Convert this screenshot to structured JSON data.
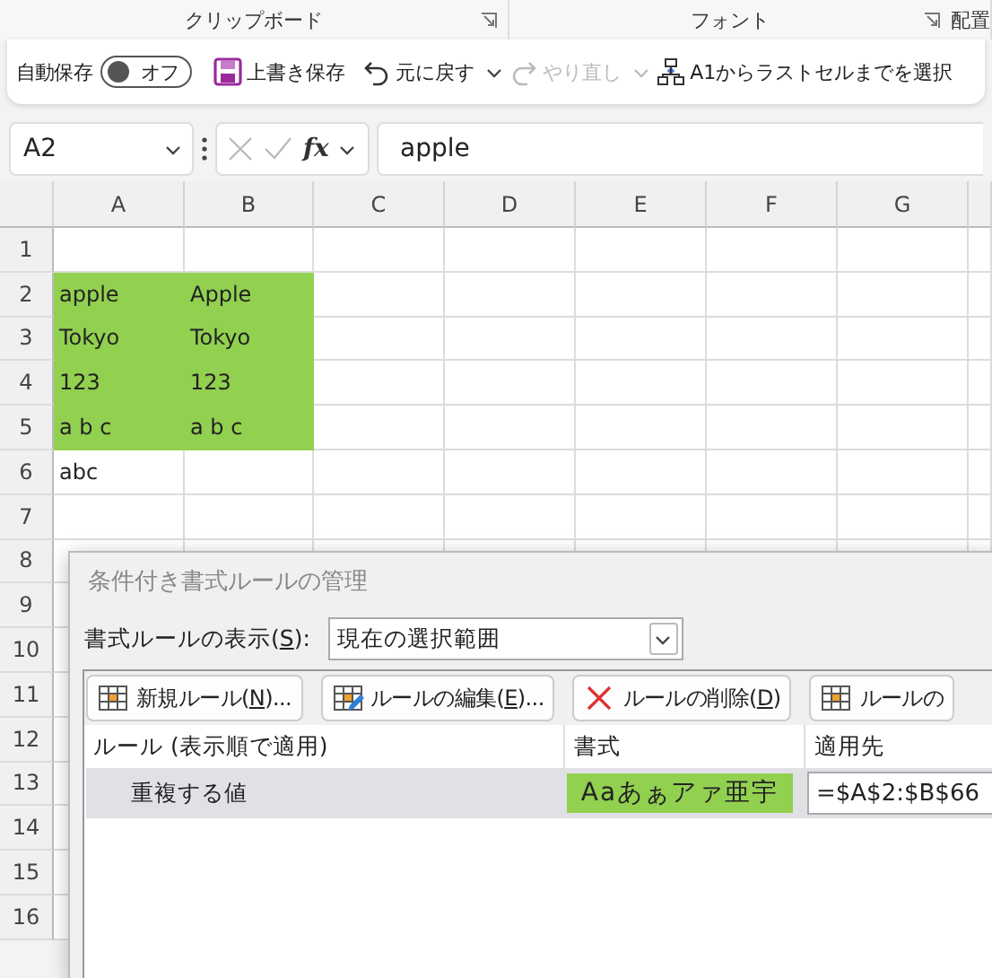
{
  "ribbon_groups": [
    {
      "label": "クリップボード",
      "launcher": true
    },
    {
      "label": "フォント",
      "launcher": true
    },
    {
      "label": "配置",
      "launcher": false
    }
  ],
  "quick_access": {
    "autosave": {
      "label": "自動保存",
      "state_label": "オフ",
      "on": false
    },
    "buttons": [
      {
        "kind": "save",
        "label": "上書き保存",
        "disabled": false,
        "dropdown": false
      },
      {
        "kind": "undo",
        "label": "元に戻す",
        "disabled": false,
        "dropdown": true
      },
      {
        "kind": "redo",
        "label": "やり直し",
        "disabled": true,
        "dropdown": true
      },
      {
        "kind": "select",
        "label": "A1からラストセルまでを選択",
        "disabled": false,
        "dropdown": false
      }
    ]
  },
  "formula_bar": {
    "name_box": "A2",
    "fx": "fx",
    "value": "apple"
  },
  "sheet": {
    "columns": [
      "A",
      "B",
      "C",
      "D",
      "E",
      "F",
      "G"
    ],
    "rows": [
      {
        "label": "1"
      },
      {
        "label": "2",
        "cells": [
          {
            "text": "apple",
            "highlighted": true
          },
          {
            "text": "Apple",
            "highlighted": true
          }
        ]
      },
      {
        "label": "3",
        "cells": [
          {
            "text": "Tokyo",
            "highlighted": true
          },
          {
            "text": "Tokyo",
            "highlighted": true
          }
        ]
      },
      {
        "label": "4",
        "cells": [
          {
            "text": "123",
            "highlighted": true
          },
          {
            "text": "123",
            "highlighted": true
          }
        ]
      },
      {
        "label": "5",
        "cells": [
          {
            "text": "a b c",
            "highlighted": true
          },
          {
            "text": "a b c",
            "highlighted": true
          }
        ]
      },
      {
        "label": "6",
        "cells": [
          {
            "text": "abc",
            "highlighted": false
          }
        ]
      },
      {
        "label": "7"
      },
      {
        "label": "8"
      },
      {
        "label": "9"
      },
      {
        "label": "10"
      },
      {
        "label": "11"
      },
      {
        "label": "12"
      },
      {
        "label": "13"
      },
      {
        "label": "14"
      },
      {
        "label": "15"
      },
      {
        "label": "16"
      }
    ]
  },
  "dialog": {
    "title": "条件付き書式ルールの管理",
    "show_rules_for": {
      "label": [
        "書式ルールの表示(",
        "S",
        "):"
      ],
      "value": "現在の選択範囲"
    },
    "buttons": [
      {
        "kind": "new",
        "label": [
          "新規ルール(",
          "N",
          ")..."
        ]
      },
      {
        "kind": "edit",
        "label": [
          "ルールの編集(",
          "E",
          ")..."
        ]
      },
      {
        "kind": "delete",
        "label": [
          "ルールの削除(",
          "D",
          ")"
        ]
      },
      {
        "kind": "duplicate",
        "label": [
          "ルールの"
        ]
      }
    ],
    "columns": [
      "ルール (表示順で適用)",
      "書式",
      "適用先"
    ],
    "rules": [
      {
        "name": "重複する値",
        "preview": "Aaあぁアァ亜宇",
        "applies_to": "=$A$2:$B$66",
        "selected": true
      }
    ]
  }
}
